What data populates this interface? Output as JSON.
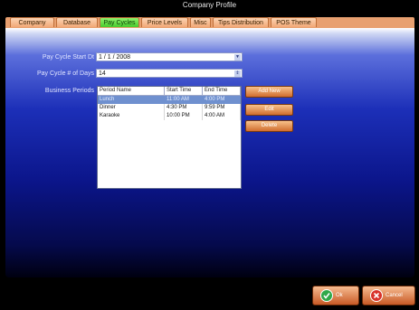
{
  "window": {
    "title": "Company Profile"
  },
  "tabs": [
    {
      "label": "Company"
    },
    {
      "label": "Database"
    },
    {
      "label": "Pay Cycles",
      "active": true
    },
    {
      "label": "Price Levels"
    },
    {
      "label": "Misc"
    },
    {
      "label": "Tips Distribution"
    },
    {
      "label": "POS Theme"
    }
  ],
  "form": {
    "start_label": "Pay Cycle Start Dt",
    "start_value": "1 /   1 / 2008",
    "days_label": "Pay Cycle # of Days",
    "days_value": "14",
    "periods_label": "Business Periods"
  },
  "periods": {
    "columns": [
      "Period Name",
      "Start Time",
      "End Time"
    ],
    "rows": [
      {
        "name": "Lunch",
        "start": "11:00 AM",
        "end": "4:00 PM",
        "selected": true
      },
      {
        "name": "Dinner",
        "start": "4:30 PM",
        "end": "9:59 PM"
      },
      {
        "name": "Karaoke",
        "start": "10:00 PM",
        "end": "4:00 AM"
      }
    ]
  },
  "actions": {
    "add": "Add New",
    "edit": "Edit",
    "delete": "Delete"
  },
  "footer": {
    "ok": "Ok",
    "cancel": "Cancel"
  },
  "colors": {
    "tab_active": "#47c92e",
    "tab": "#f2a877",
    "button": "#d06d2e",
    "selection": "#6f90cf"
  }
}
